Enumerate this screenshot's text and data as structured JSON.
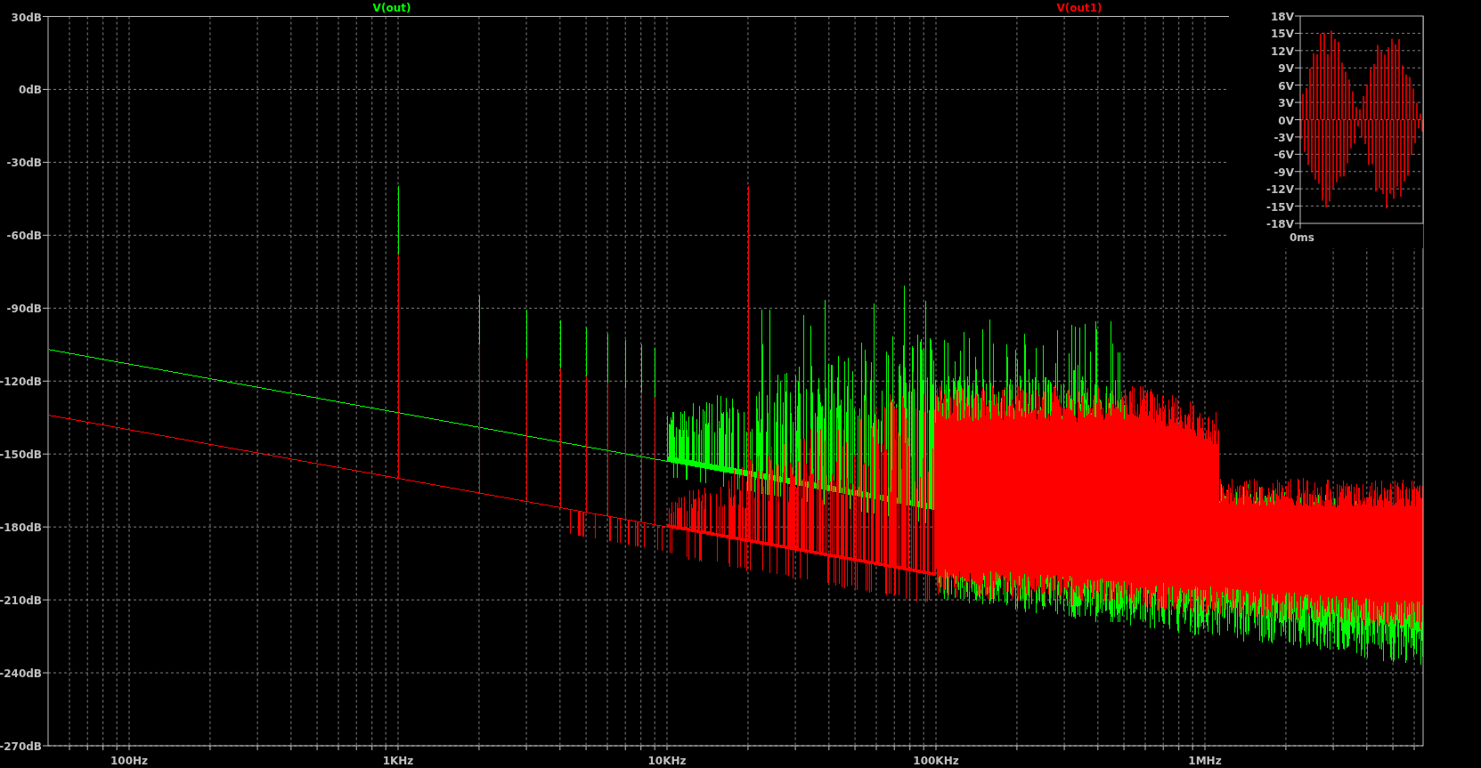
{
  "plot": {
    "traces": [
      {
        "name": "V(out)",
        "color": "#00ff00"
      },
      {
        "name": "V(out1)",
        "color": "#ff0000"
      }
    ],
    "y_ticks": [
      "30dB",
      "0dB",
      "-30dB",
      "-60dB",
      "-90dB",
      "-120dB",
      "-150dB",
      "-180dB",
      "-210dB",
      "-240dB",
      "-270dB"
    ],
    "x_ticks": [
      "100Hz",
      "1KHz",
      "10KHz",
      "100KHz",
      "1MHz"
    ]
  },
  "inset": {
    "y_ticks": [
      "18V",
      "15V",
      "12V",
      "9V",
      "6V",
      "3V",
      "0V",
      "-3V",
      "-6V",
      "-9V",
      "-12V",
      "-15V",
      "-18V"
    ],
    "x_ticks": [
      "0ms"
    ]
  }
}
